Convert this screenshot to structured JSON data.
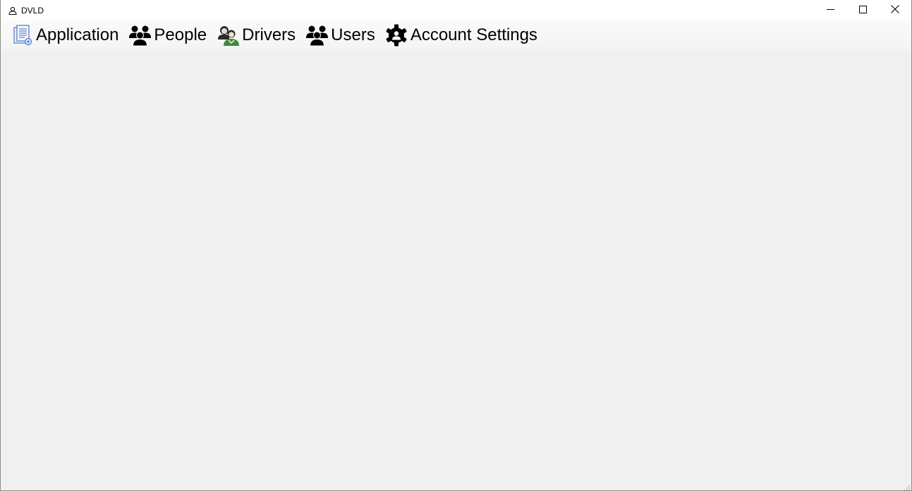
{
  "window": {
    "title": "DVLD",
    "icon": "user-outline-icon"
  },
  "caption": {
    "minimize_icon": "minimize-icon",
    "maximize_icon": "maximize-icon",
    "close_icon": "close-icon"
  },
  "menu": {
    "items": [
      {
        "label": "Application",
        "icon": "application-document-icon"
      },
      {
        "label": "People",
        "icon": "people-group-icon"
      },
      {
        "label": "Drivers",
        "icon": "drivers-icon"
      },
      {
        "label": "Users",
        "icon": "users-group-icon"
      },
      {
        "label": "Account Settings",
        "icon": "gear-user-icon"
      }
    ]
  },
  "colors": {
    "titlebar_bg": "#ffffff",
    "client_bg": "#f0f0f0",
    "icon_dark": "#000000",
    "application_icon_blue": "#5b7fc7",
    "drivers_icon_green": "#3c8c3c"
  }
}
